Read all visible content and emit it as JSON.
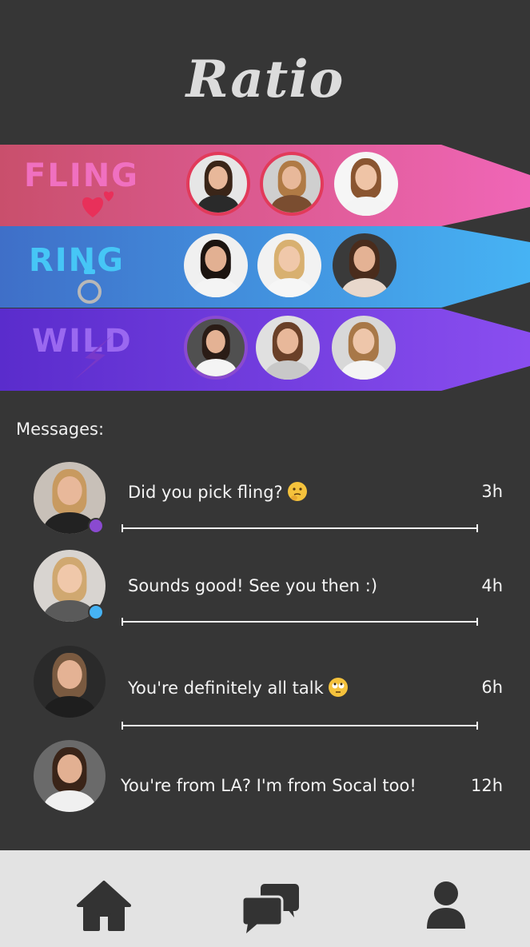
{
  "app": {
    "title": "Ratio"
  },
  "categories": [
    {
      "label": "FLING",
      "icon": "hearts-icon",
      "gradient": [
        "#c94f6c",
        "#f066b7"
      ],
      "label_color": "#f070c0",
      "avatars": [
        {
          "hair": "#3a2518",
          "skin": "#e8b89a",
          "top": "#2a2a2a",
          "bg": "#e6e6e6",
          "ring": "#e23a5a"
        },
        {
          "hair": "#b07a45",
          "skin": "#e8b89a",
          "top": "#7a4d30",
          "bg": "#cfcfcf",
          "ring": "#e23a5a"
        },
        {
          "hair": "#8a5530",
          "skin": "#efc4a6",
          "top": "#f4f4f4",
          "bg": "#f6f6f6",
          "ring": "none"
        }
      ]
    },
    {
      "label": "RING",
      "icon": "ring-icon",
      "gradient": [
        "#3f6fc8",
        "#46b3f4"
      ],
      "label_color": "#46c6f6",
      "avatars": [
        {
          "hair": "#1c1410",
          "skin": "#e2b092",
          "top": "#f4f4f4",
          "bg": "#f0f0f0",
          "ring": "none"
        },
        {
          "hair": "#d8b070",
          "skin": "#f0c8aa",
          "top": "#f6f6f6",
          "bg": "#f2f2f2",
          "ring": "none"
        },
        {
          "hair": "#4a2c1c",
          "skin": "#e4b294",
          "top": "#e8d8cc",
          "bg": "#3a3a3a",
          "ring": "none"
        }
      ]
    },
    {
      "label": "WILD",
      "icon": "lightning-icon",
      "gradient": [
        "#5a2ccc",
        "#8a4ef0"
      ],
      "label_color": "#9a68f0",
      "avatars": [
        {
          "hair": "#2a1c16",
          "skin": "#e4b294",
          "top": "#f4f4f4",
          "bg": "#505050",
          "ring": "#8a4ad0"
        },
        {
          "hair": "#6a4028",
          "skin": "#e8b89a",
          "top": "#c8c8c8",
          "bg": "#e0e0e0",
          "ring": "none"
        },
        {
          "hair": "#a87848",
          "skin": "#eec6aa",
          "top": "#f4f4f4",
          "bg": "#d8d8d8",
          "ring": "none"
        }
      ]
    }
  ],
  "messages_heading": "Messages:",
  "messages": [
    {
      "text": "Did you pick fling?",
      "emoji": "thinking-face-emoji",
      "time": "3h",
      "status_color": "#8a4ad0",
      "avatar": {
        "hair": "#c89a60",
        "skin": "#e8b89a",
        "top": "#222222",
        "bg": "#c8c0b8"
      }
    },
    {
      "text": "Sounds good! See you then :)",
      "emoji": "",
      "time": "4h",
      "status_color": "#46b3f4",
      "avatar": {
        "hair": "#d0a870",
        "skin": "#f0c8aa",
        "top": "#5a5a5a",
        "bg": "#d8d4d0"
      }
    },
    {
      "text": "You're definitely all talk",
      "emoji": "eye-roll-emoji",
      "time": "6h",
      "status_color": "",
      "avatar": {
        "hair": "#7a5a40",
        "skin": "#e4b294",
        "top": "#1e1e1e",
        "bg": "#2a2a2a"
      }
    },
    {
      "text": "You're from LA? I'm from Socal too!",
      "emoji": "",
      "time": "12h",
      "status_color": "",
      "avatar": {
        "hair": "#3a2418",
        "skin": "#e2b092",
        "top": "#f0f0f0",
        "bg": "#6a6a6a"
      }
    }
  ],
  "nav": {
    "items": [
      {
        "icon": "home-icon"
      },
      {
        "icon": "chat-icon"
      },
      {
        "icon": "profile-icon"
      }
    ],
    "icon_color": "#333333"
  }
}
